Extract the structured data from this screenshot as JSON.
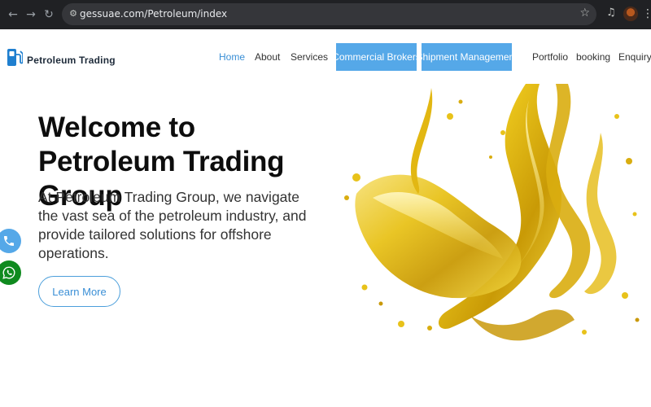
{
  "browser": {
    "url": "gessuae.com/Petroleum/index",
    "icons": [
      "back-arrow-icon",
      "forward-arrow-icon",
      "reload-icon",
      "site-settings-icon",
      "bookmark-star-icon",
      "media-controls-icon",
      "profile-avatar",
      "more-menu-icon"
    ]
  },
  "brand": {
    "name": "Petroleum Trading",
    "icon": "fuel-pump-icon"
  },
  "nav": {
    "home": "Home",
    "about": "About",
    "services": "Services",
    "commercial_brokers": "Commercial Brokers",
    "shipment_management": "Shipment Management",
    "portfolio": "Portfolio",
    "booking": "booking",
    "enquiry": "Enquiry"
  },
  "hero": {
    "title": "Welcome to Petroleum Trading Group",
    "text": "At Petroleum Trading Group, we navigate the vast sea of the petroleum industry, and provide tailored solutions for offshore operations.",
    "button": "Learn More",
    "image": "golden-oil-splash"
  },
  "floating": {
    "icons": [
      "phone-icon",
      "whatsapp-icon"
    ]
  },
  "colors": {
    "accent": "#55a8e8",
    "active_link": "#3a8fd6",
    "whatsapp": "#0f8a1f",
    "title": "#0d0d0d",
    "oil_gold": "#e8c21a"
  }
}
